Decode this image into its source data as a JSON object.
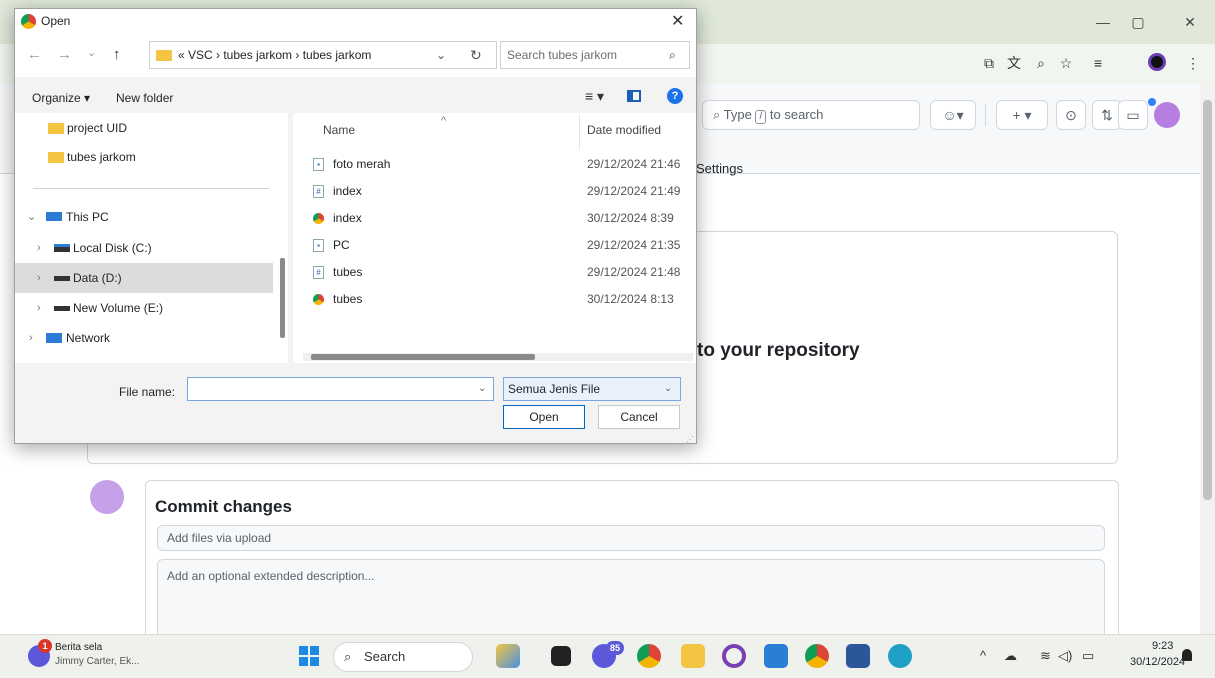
{
  "browser": {
    "minimize": "—",
    "restore": "▢",
    "close": "✕",
    "toolbar_icons": [
      "cast-icon",
      "translate-icon",
      "zoom-icon",
      "star-icon",
      "reading-list-icon",
      "profile-icon",
      "more-icon"
    ]
  },
  "github": {
    "search_prefix": "Type",
    "search_key": "/",
    "search_suffix": "to search",
    "settings_tab": "Settings",
    "upload_heading": "to your repository",
    "commit_title": "Commit changes",
    "commit_placeholder": "Add files via upload",
    "description_placeholder": "Add an optional extended description..."
  },
  "dialog": {
    "title": "Open",
    "close": "✕",
    "address_path": "« VSC › tubes jarkom › tubes jarkom",
    "search_placeholder": "Search tubes jarkom",
    "organize": "Organize ▾",
    "new_folder": "New folder",
    "nav_items": [
      {
        "label": "project UID",
        "icon": "folder-icon"
      },
      {
        "label": "tubes jarkom",
        "icon": "folder-icon"
      },
      {
        "label": "This PC",
        "icon": "pc-icon",
        "expander": "⌄"
      },
      {
        "label": "Local Disk (C:)",
        "icon": "disk-icon",
        "expander": "›"
      },
      {
        "label": "Data (D:)",
        "icon": "disk-icon",
        "expander": "›",
        "selected": true
      },
      {
        "label": "New Volume (E:)",
        "icon": "disk-icon",
        "expander": "›"
      },
      {
        "label": "Network",
        "icon": "network-icon",
        "expander": "›"
      }
    ],
    "columns": {
      "name": "Name",
      "date": "Date modified"
    },
    "files": [
      {
        "name": "foto merah",
        "date": "29/12/2024 21:46",
        "icon": "image-file-icon"
      },
      {
        "name": "index",
        "date": "29/12/2024 21:49",
        "icon": "css-file-icon"
      },
      {
        "name": "index",
        "date": "30/12/2024 8:39",
        "icon": "chrome-html-icon"
      },
      {
        "name": "PC",
        "date": "29/12/2024 21:35",
        "icon": "image-file-icon"
      },
      {
        "name": "tubes",
        "date": "29/12/2024 21:48",
        "icon": "css-file-icon"
      },
      {
        "name": "tubes",
        "date": "30/12/2024 8:13",
        "icon": "chrome-html-icon"
      }
    ],
    "file_name_label": "File name:",
    "file_name_value": "",
    "file_type": "Semua Jenis File",
    "open_button": "Open",
    "cancel_button": "Cancel"
  },
  "taskbar": {
    "news_badge": "1",
    "news_title": "Berita sela",
    "news_subtitle": "Jimmy Carter, Ek...",
    "search_label": "Search",
    "chat_badge": "85",
    "clock_time": "9:23",
    "clock_date": "30/12/2024"
  },
  "colors": {
    "accent": "#1a73e8",
    "dialog_bg": "#f3f3f3",
    "selection": "#dcdcdc",
    "titlebar": "#dfe8d9"
  }
}
